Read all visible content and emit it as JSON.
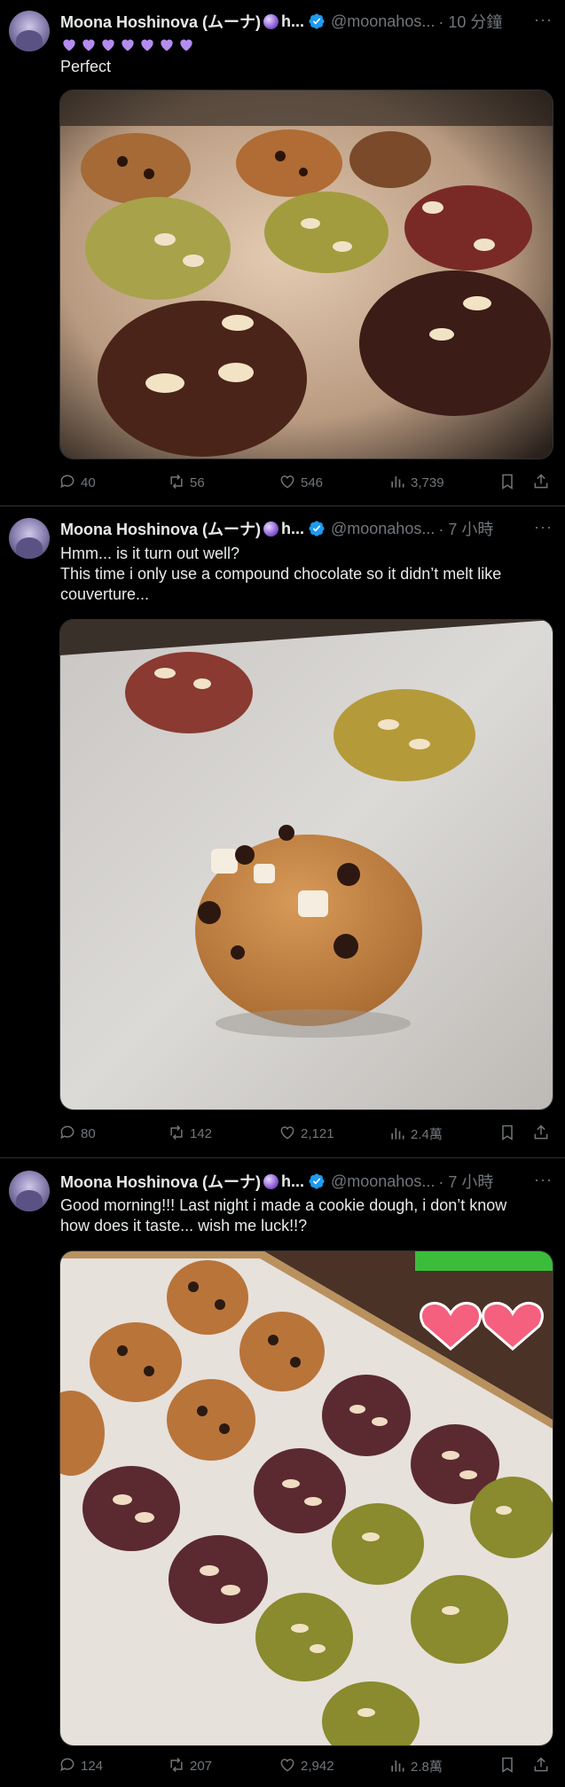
{
  "tweets": [
    {
      "author": "Moona Hoshinova (ムーナ)",
      "name_suffix": "h...",
      "handle": "@moonahos...",
      "time": "· 10 分鐘",
      "hearts": [
        "purple-heart",
        "purple-heart",
        "purple-heart",
        "purple-heart",
        "purple-heart",
        "purple-heart",
        "purple-heart"
      ],
      "text": "Perfect",
      "photo": "Eight baked cookies (chocolate chip, matcha, red velvet, cocoa) with sliced almonds on parchment",
      "stats": {
        "replies": "40",
        "reposts": "56",
        "likes": "546",
        "views": "3,739"
      }
    },
    {
      "author": "Moona Hoshinova (ムーナ)",
      "name_suffix": "h...",
      "handle": "@moonahos...",
      "time": "· 7 小時",
      "text": "Hmm... is it turn out well?\nThis time i only use a compound chocolate so it didn’t melt like couverture...",
      "photo": "Three baked cookies on parchment: chocolate chip in front, red velvet and matcha behind",
      "stats": {
        "replies": "80",
        "reposts": "142",
        "likes": "2,121",
        "views": "2.4萬"
      }
    },
    {
      "author": "Moona Hoshinova (ムーナ)",
      "name_suffix": "h...",
      "handle": "@moonahos...",
      "time": "· 7 小時",
      "text": "Good morning!!! Last night i made a cookie dough, i don’t know how does it taste... wish me luck!!?",
      "photo": "Tray of unbaked cookie dough balls in rows: chocolate chip, cocoa with almonds, matcha with almonds; two pink heart stickers",
      "stats": {
        "replies": "124",
        "reposts": "207",
        "likes": "2,942",
        "views": "2.8萬"
      }
    }
  ],
  "colors": {
    "background": "#000000",
    "text": "#e7e9ea",
    "muted": "#71767b",
    "divider": "#2f3336",
    "verified": "#1d9bf0",
    "heart_emoji": "#b48cf0"
  },
  "icons": [
    "reply-icon",
    "repost-icon",
    "like-icon",
    "views-icon",
    "bookmark-icon",
    "share-icon",
    "verified-icon",
    "more-icon"
  ]
}
